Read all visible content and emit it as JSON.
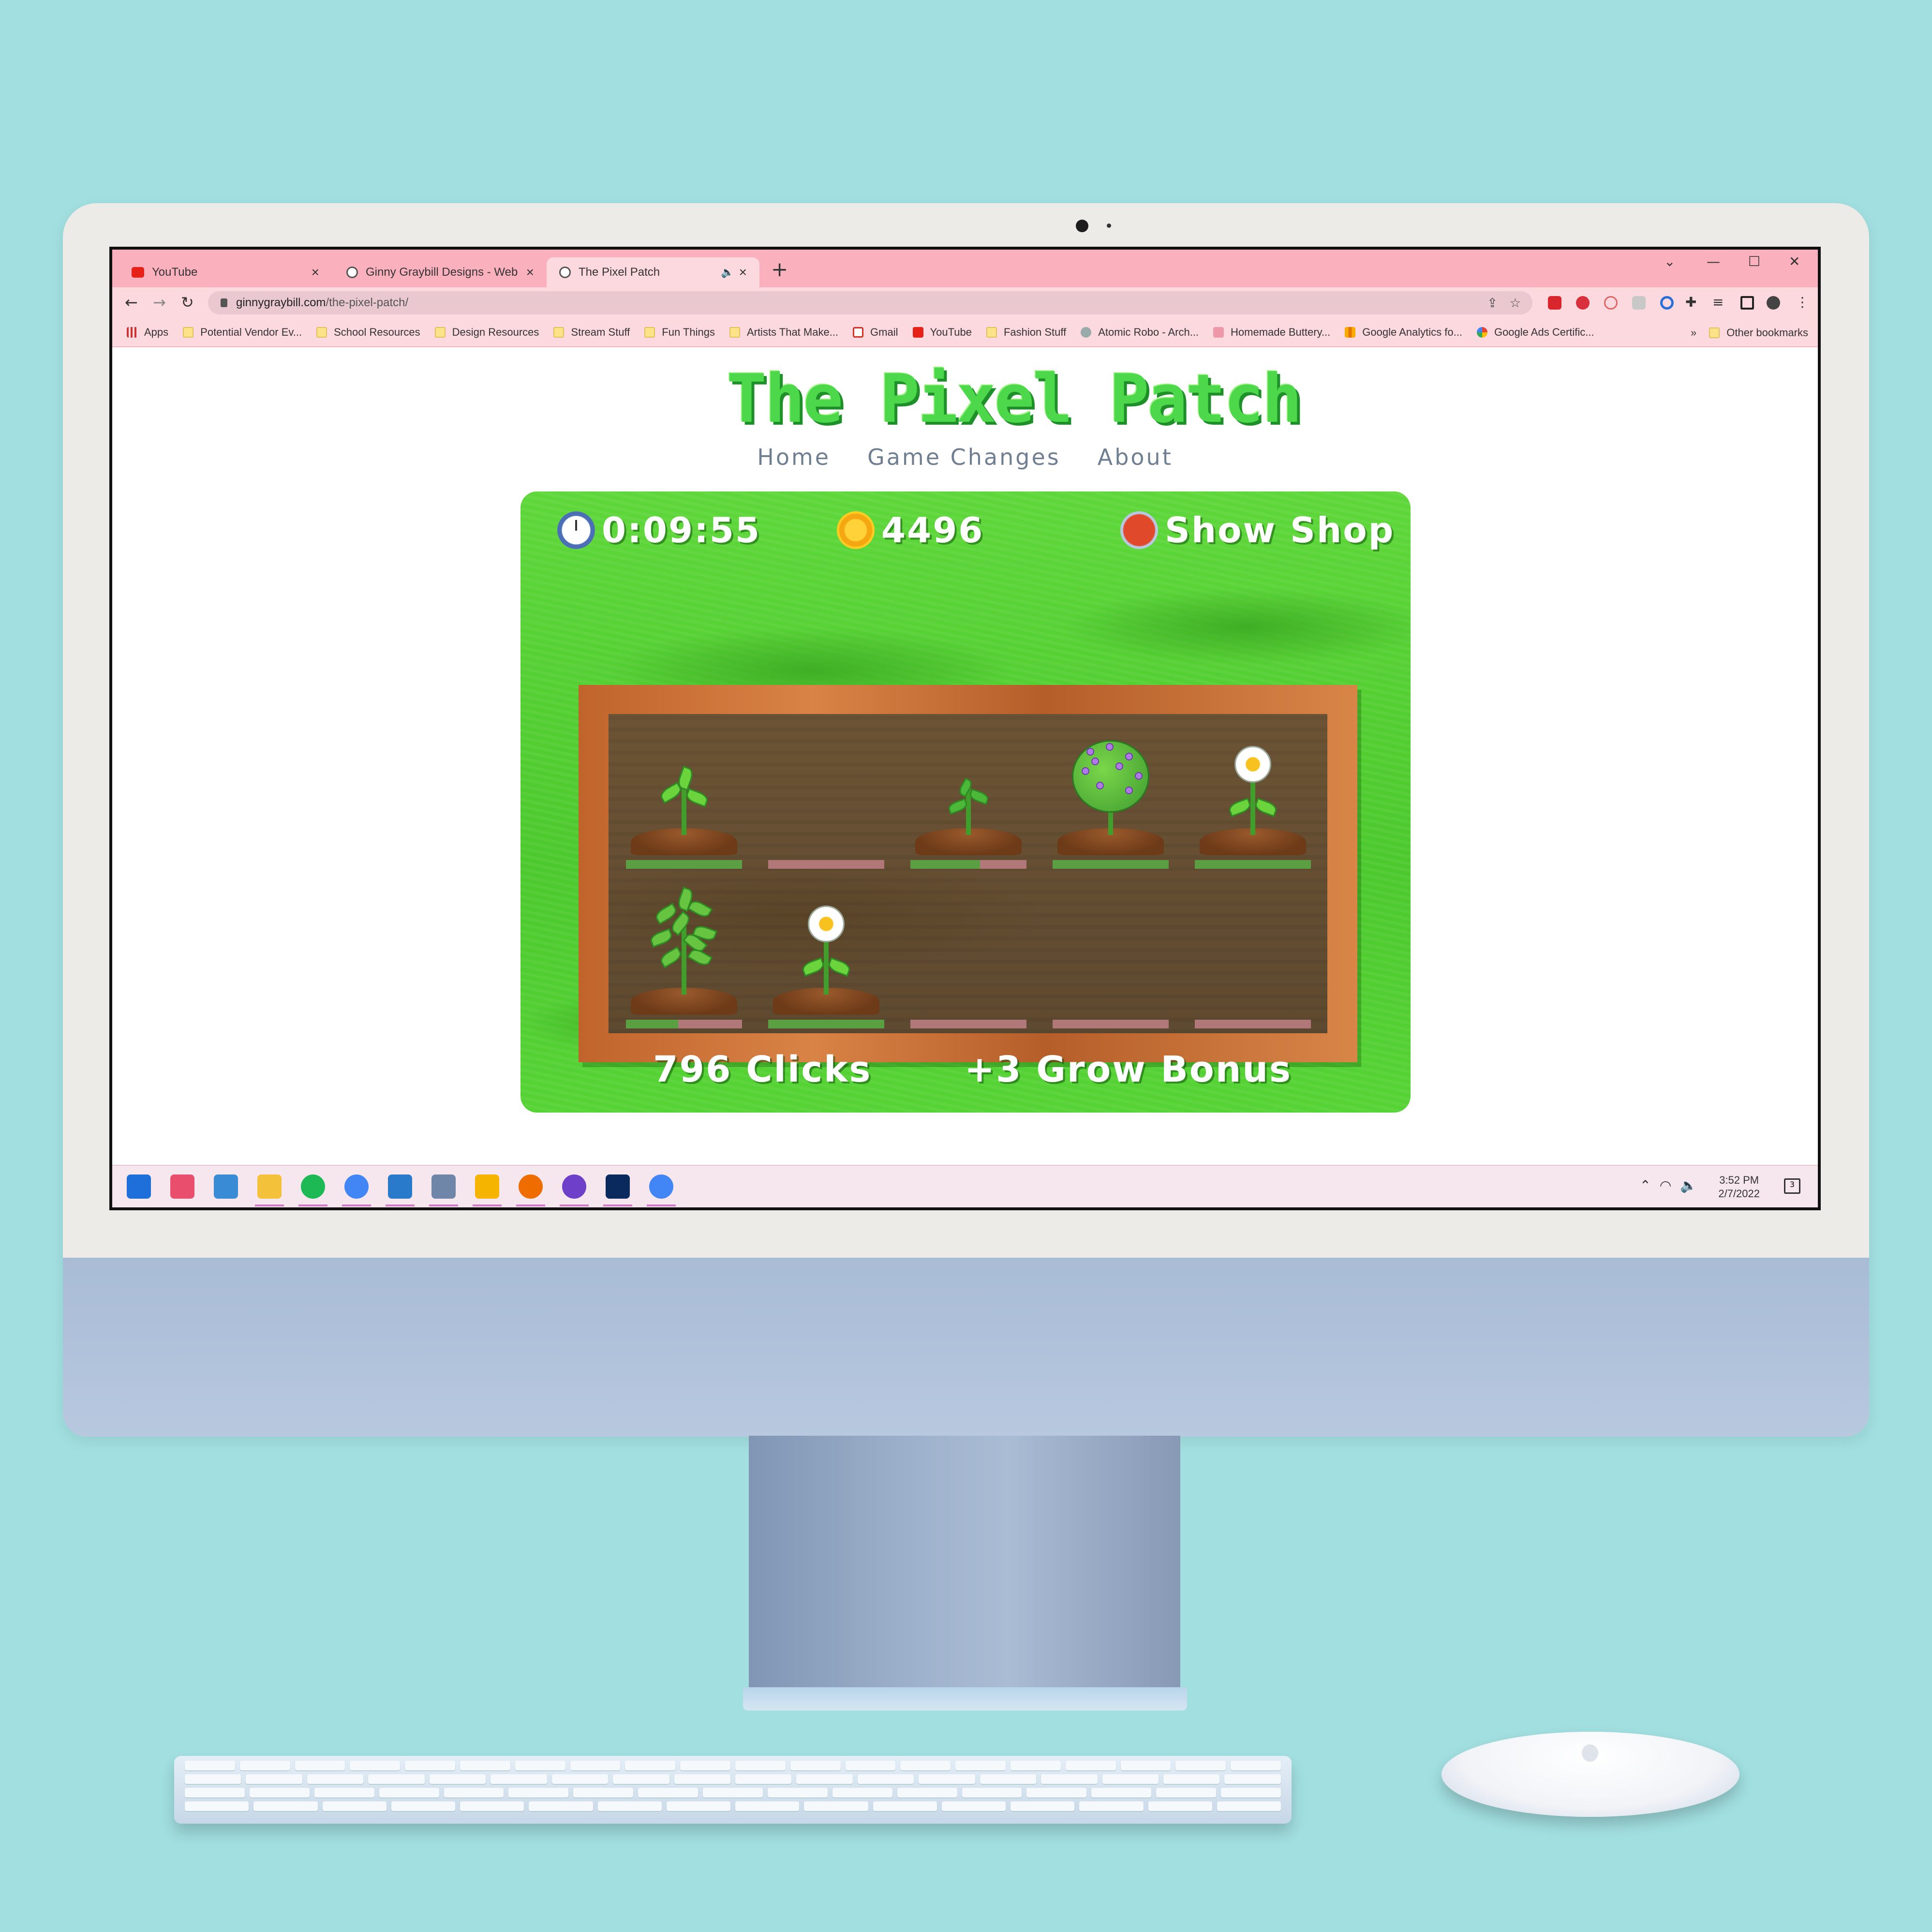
{
  "browser": {
    "tabs": [
      {
        "label": "YouTube",
        "icon": "youtube-icon"
      },
      {
        "label": "Ginny Graybill Designs - Web and",
        "icon": "globe-icon"
      },
      {
        "label": "The Pixel Patch",
        "icon": "globe-icon",
        "active": true
      }
    ],
    "url_domain": "ginnygraybill.com",
    "url_path": "/the-pixel-patch/",
    "bookmarks": [
      {
        "label": "Apps",
        "icon": "apps-grid-icon"
      },
      {
        "label": "Potential Vendor Ev...",
        "icon": "folder-icon"
      },
      {
        "label": "School Resources",
        "icon": "folder-icon"
      },
      {
        "label": "Design Resources",
        "icon": "folder-icon"
      },
      {
        "label": "Stream Stuff",
        "icon": "folder-icon"
      },
      {
        "label": "Fun Things",
        "icon": "folder-icon"
      },
      {
        "label": "Artists That Make...",
        "icon": "folder-icon"
      },
      {
        "label": "Gmail",
        "icon": "gmail-icon"
      },
      {
        "label": "YouTube",
        "icon": "youtube-icon"
      },
      {
        "label": "Fashion Stuff",
        "icon": "folder-icon"
      },
      {
        "label": "Atomic Robo - Arch...",
        "icon": "robot-icon"
      },
      {
        "label": "Homemade Buttery...",
        "icon": "bird-icon"
      },
      {
        "label": "Google Analytics fo...",
        "icon": "analytics-icon"
      },
      {
        "label": "Google Ads Certific...",
        "icon": "google-icon"
      }
    ],
    "bookmarks_overflow": "»",
    "other_bookmarks": "Other bookmarks"
  },
  "site": {
    "logo": "The Pixel Patch",
    "nav": [
      "Home",
      "Game Changes",
      "About"
    ]
  },
  "game": {
    "timer": "0:09:55",
    "coins": "4496",
    "shop_label": "Show Shop",
    "clicks_label": "796 Clicks",
    "bonus_label": "+3 Grow Bonus",
    "plots": [
      {
        "plant": "sprout",
        "growth": 1.0
      },
      {
        "plant": "empty",
        "growth": 0.0
      },
      {
        "plant": "seedling",
        "growth": 0.6
      },
      {
        "plant": "lilac-bush",
        "growth": 1.0
      },
      {
        "plant": "daisy",
        "growth": 1.0
      },
      {
        "plant": "leafy-shrub",
        "growth": 0.45
      },
      {
        "plant": "daisy",
        "growth": 1.0
      },
      {
        "plant": "empty",
        "growth": 0.0
      },
      {
        "plant": "empty",
        "growth": 0.0
      },
      {
        "plant": "empty",
        "growth": 0.0
      }
    ]
  },
  "taskbar": {
    "apps": [
      "windows-start-icon",
      "snip-icon",
      "photos-icon",
      "file-explorer-icon",
      "spotify-icon",
      "chrome-icon",
      "vscode-icon",
      "calculator-icon",
      "app-icon",
      "xampp-icon",
      "github-icon",
      "photoshop-icon",
      "chrome-profile-icon"
    ],
    "time": "3:52 PM",
    "date": "2/7/2022",
    "notifications": "3"
  },
  "colors": {
    "tabbar": "#fbb0bd",
    "toolbar": "#fcd8df",
    "grass": "#4cc92d",
    "soil": "#5e4a30",
    "wood": "#c8703a",
    "nav_text": "#6f7f91",
    "desk_background": "#a2dfe0"
  }
}
